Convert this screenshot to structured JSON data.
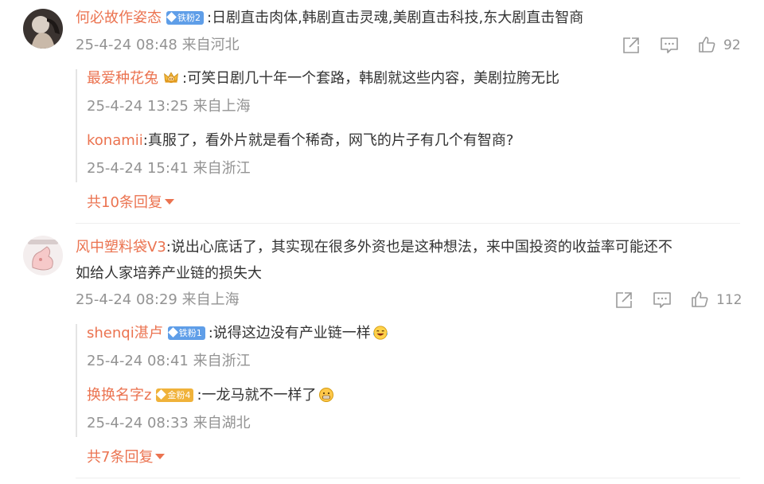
{
  "comments": [
    {
      "username": "何必故作姿态",
      "badge": "铁粉2",
      "text": ":日剧直击肉体,韩剧直击灵魂,美剧直击科技,东大剧直击智商",
      "time": "25-4-24 08:48",
      "location": "来自河北",
      "likes": "92",
      "replies": [
        {
          "username": "最爱种花兔",
          "icon": "crown-emoji-icon",
          "text": ":可笑日剧几十年一个套路，韩剧就这些内容，美剧拉胯无比",
          "time": "25-4-24 13:25",
          "location": "来自上海"
        },
        {
          "username": "konamii",
          "text": ":真服了，看外片就是看个稀奇，网飞的片子有几个有智商?",
          "time": "25-4-24 15:41",
          "location": "来自浙江"
        }
      ],
      "more_replies": "共10条回复"
    },
    {
      "username": "风中塑料袋V3",
      "text_line1": ":说出心底话了，其实现在很多外资也是这种想法，来中国投资的收益率可能还不",
      "text_line2": "如给人家培养产业链的损失大",
      "time": "25-4-24 08:29",
      "location": "来自上海",
      "likes": "112",
      "replies": [
        {
          "username": "shenqi湛卢",
          "badge": "铁粉1",
          "text": ":说得这边没有产业链一样",
          "icon": "laugh-cry-emoji-icon",
          "time": "25-4-24 08:41",
          "location": "来自浙江"
        },
        {
          "username": "换换名字z",
          "badge": "金粉4",
          "text": ":一龙马就不一样了",
          "icon": "grimace-emoji-icon",
          "time": "25-4-24 08:33",
          "location": "来自湖北"
        }
      ],
      "more_replies": "共7条回复"
    }
  ],
  "icons": {
    "share": "share-icon",
    "comment": "comment-icon",
    "like": "thumbs-up-icon"
  },
  "colors": {
    "username": "#eb7350",
    "meta": "#939393",
    "text": "#333333",
    "iron_badge": "#5f9ee8",
    "gold_badge": "#f0b23a"
  }
}
